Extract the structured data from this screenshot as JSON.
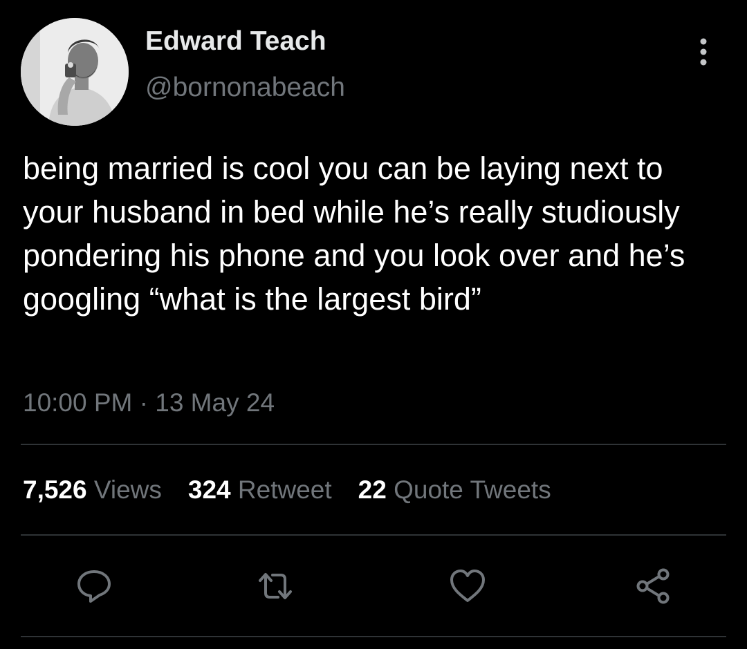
{
  "author": {
    "display_name": "Edward Teach",
    "handle": "@bornonabeach",
    "avatar_icon": "profile-photo"
  },
  "menu": {
    "more_icon": "more-vertical-icon"
  },
  "tweet": {
    "text": "being married is cool you can be laying next to your husband in bed while he’s really studiously pondering his phone and you look over and he’s googling “what is the largest bird”",
    "timestamp": "10:00 PM · 13 May 24"
  },
  "stats": {
    "views_count": "7,526",
    "views_label": "Views",
    "retweets_count": "324",
    "retweets_label": "Retweet",
    "quotes_count": "22",
    "quotes_label": "Quote Tweets"
  },
  "actions": {
    "reply_icon": "reply-icon",
    "retweet_icon": "retweet-icon",
    "like_icon": "heart-icon",
    "share_icon": "share-icon"
  },
  "colors": {
    "background": "#000000",
    "primary_text": "#e7e9ea",
    "secondary_text": "#71767b",
    "divider": "#2f3336"
  }
}
